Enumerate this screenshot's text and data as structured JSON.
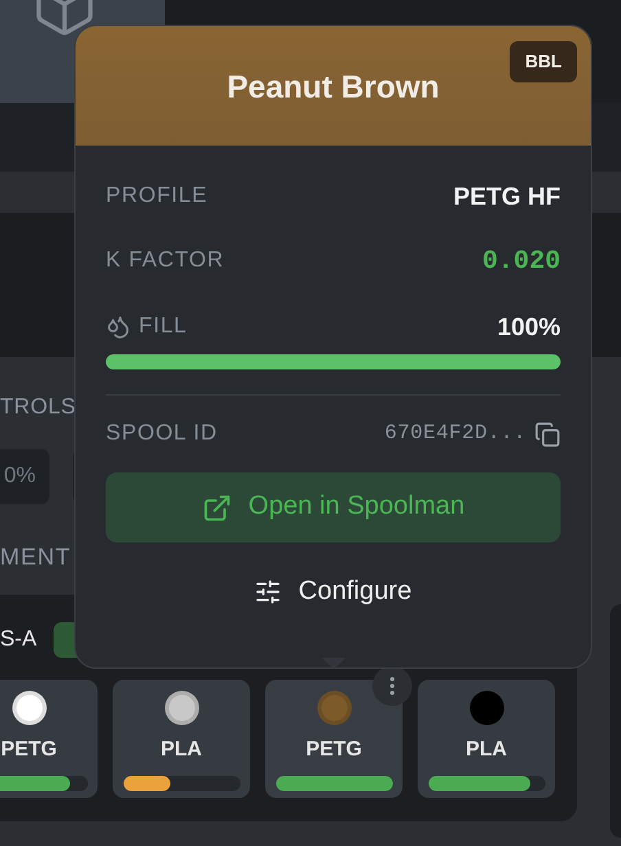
{
  "background": {
    "controls_label": "TROLS",
    "field_value": "0%",
    "section_label": "MENT",
    "unit_label": "S-A"
  },
  "popover": {
    "title": "Peanut Brown",
    "color": "#8a6533",
    "badge": "BBL",
    "profile_label": "PROFILE",
    "profile": "PETG HF",
    "k_label": "K FACTOR",
    "k_value": "0.020",
    "fill": {
      "label": "FILL",
      "value": "100%",
      "level": 1.0
    },
    "spool_label": "SPOOL ID",
    "spool_id": "670E4F2D...",
    "open_button": "Open in Spoolman",
    "configure_button": "Configure"
  },
  "spools": [
    {
      "material": "PETG",
      "color": "#ffffff",
      "level": 0.85,
      "selected": false
    },
    {
      "material": "PLA",
      "color": "#c8c8c8",
      "level": 0.41,
      "selected": false
    },
    {
      "material": "PETG",
      "color": "#7d5a2a",
      "level": 1.0,
      "selected": true
    },
    {
      "material": "PLA",
      "color": "#000000",
      "level": 0.88,
      "selected": false
    }
  ]
}
